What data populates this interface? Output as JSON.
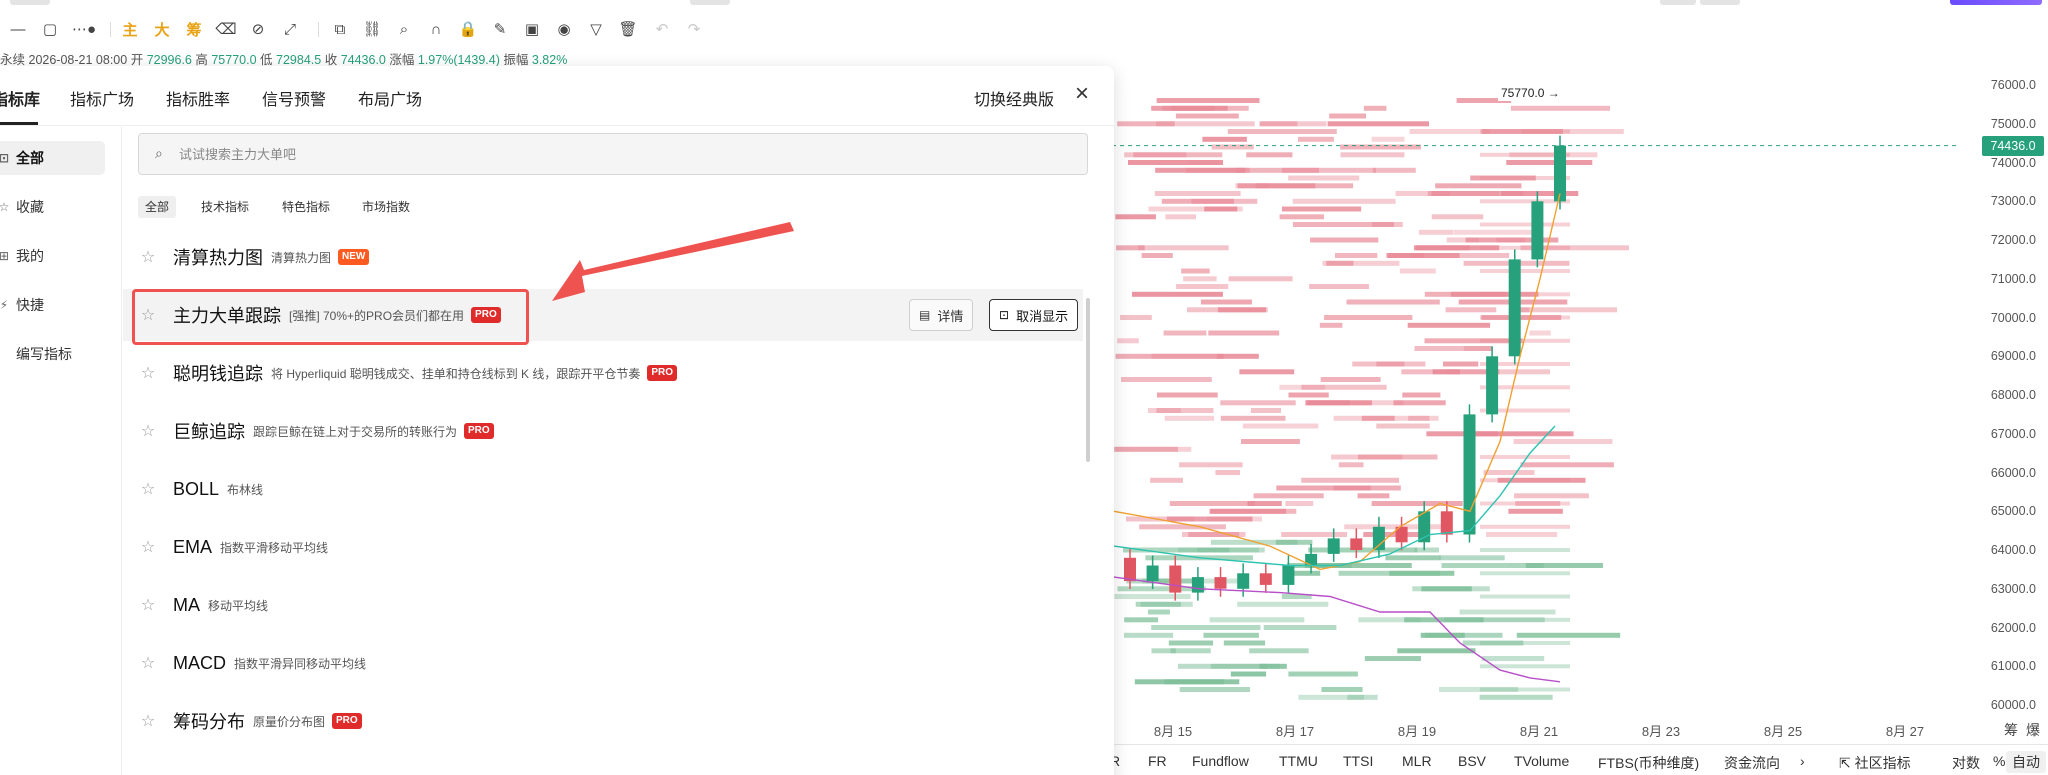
{
  "toolbar": {
    "icons": [
      {
        "name": "minus-line-icon",
        "glyph": "—"
      },
      {
        "name": "rectangle-icon",
        "glyph": "▢"
      },
      {
        "name": "dotted-arrow-icon",
        "glyph": "⋯●"
      },
      {
        "name": "main-chart-icon",
        "glyph": "主"
      },
      {
        "name": "large-icon",
        "glyph": "大"
      },
      {
        "name": "chip-icon",
        "glyph": "筹"
      },
      {
        "name": "eraser-icon",
        "glyph": "⌫"
      },
      {
        "name": "ruler-icon",
        "glyph": "⊘"
      },
      {
        "name": "measure-icon",
        "glyph": "⤢"
      },
      {
        "name": "copy-icon",
        "glyph": "⧉"
      },
      {
        "name": "link-icon",
        "glyph": "⛓"
      },
      {
        "name": "zoom-icon",
        "glyph": "⌕"
      },
      {
        "name": "magnet-icon",
        "glyph": "∩"
      },
      {
        "name": "lock-icon",
        "glyph": "🔒"
      },
      {
        "name": "pen-icon",
        "glyph": "✎"
      },
      {
        "name": "image-icon",
        "glyph": "▣"
      },
      {
        "name": "eye-icon",
        "glyph": "◉"
      },
      {
        "name": "filter-icon",
        "glyph": "▽"
      },
      {
        "name": "trash-icon",
        "glyph": "🗑"
      },
      {
        "name": "undo-icon",
        "glyph": "↶"
      },
      {
        "name": "redo-icon",
        "glyph": "↷"
      }
    ]
  },
  "ohlc": {
    "label": "永续",
    "time": "2026-08-21 08:00",
    "open_label": "开",
    "open": "72996.6",
    "high_label": "高",
    "high": "75770.0",
    "low_label": "低",
    "low": "72984.5",
    "close_label": "收",
    "close": "74436.0",
    "change_label": "涨幅",
    "change": "1.97%(1439.4)",
    "amp_label": "振幅",
    "amp": "3.82%"
  },
  "chart": {
    "high_tag": "75770.0 →",
    "current_price": "74436.0",
    "price_ticks": [
      "76000.0",
      "75000.0",
      "74000.0",
      "73000.0",
      "72000.0",
      "71000.0",
      "70000.0",
      "69000.0",
      "68000.0",
      "67000.0",
      "66000.0",
      "65000.0",
      "64000.0",
      "63000.0",
      "62000.0",
      "61000.0",
      "60000.0"
    ],
    "date_ticks": [
      "8月 15",
      "8月 17",
      "8月 19",
      "8月 21",
      "8月 23",
      "8月 25",
      "8月 27"
    ],
    "corner_labels": [
      "筹",
      "爆"
    ],
    "colors": {
      "up": "#26a17b",
      "down": "#e05663",
      "heat_up": "#7fbf9a",
      "heat_down": "#e88a97",
      "ma_orange": "#f0a030",
      "ma_teal": "#2cc3b0",
      "ma_purple": "#b84fc9",
      "current_line": "#26a17b"
    }
  },
  "bottom_tabs": {
    "items": [
      "R",
      "FR",
      "Fundflow",
      "TTMU",
      "TTSI",
      "MLR",
      "BSV",
      "TVolume",
      "FTBS(币种维度)",
      "资金流向"
    ],
    "more": "›",
    "community": "社区指标",
    "log": "对数",
    "percent": "%",
    "auto": "自动"
  },
  "panel": {
    "tabs": [
      "指标库",
      "指标广场",
      "指标胜率",
      "信号预警",
      "布局广场"
    ],
    "classic": "切换经典版",
    "close": "×",
    "side_items": [
      {
        "icon": "⊡",
        "label": "全部"
      },
      {
        "icon": "☆",
        "label": "收藏"
      },
      {
        "icon": "⊞",
        "label": "我的"
      },
      {
        "icon": "⚡",
        "label": "快捷"
      },
      {
        "icon": "",
        "label": "编写指标"
      }
    ],
    "search_placeholder": "试试搜索主力大单吧",
    "filters": [
      "全部",
      "技术指标",
      "特色指标",
      "市场指数"
    ],
    "items": [
      {
        "name": "清算热力图",
        "desc": "清算热力图",
        "badge": "NEW"
      },
      {
        "name": "主力大单跟踪",
        "desc": "[强推] 70%+的PRO会员们都在用",
        "badge": "PRO"
      },
      {
        "name": "聪明钱追踪",
        "desc": "将 Hyperliquid 聪明钱成交、挂单和持仓线标到 K 线，跟踪开平仓节奏",
        "badge": "PRO"
      },
      {
        "name": "巨鲸追踪",
        "desc": "跟踪巨鲸在链上对于交易所的转账行为",
        "badge": "PRO"
      },
      {
        "name": "BOLL",
        "desc": "布林线",
        "badge": ""
      },
      {
        "name": "EMA",
        "desc": "指数平滑移动平均线",
        "badge": ""
      },
      {
        "name": "MA",
        "desc": "移动平均线",
        "badge": ""
      },
      {
        "name": "MACD",
        "desc": "指数平滑异同移动平均线",
        "badge": ""
      },
      {
        "name": "筹码分布",
        "desc": "原量价分布图",
        "badge": "PRO"
      }
    ],
    "detail_btn": "详情",
    "hide_btn": "取消显示",
    "star": "☆"
  },
  "chart_data": {
    "type": "candlestick",
    "x_label": "",
    "y_label": "",
    "ylim": [
      60000,
      76000
    ],
    "x": [
      "8月 15",
      "8月 17",
      "8月 19",
      "8月 21"
    ],
    "series": [
      {
        "values": [
          {
            "open": 63800,
            "close": 63200
          },
          {
            "open": 63200,
            "close": 63600
          },
          {
            "open": 63600,
            "close": 62900
          },
          {
            "open": 62900,
            "close": 63300
          },
          {
            "open": 63300,
            "close": 63000
          },
          {
            "open": 63000,
            "close": 63400
          },
          {
            "open": 63400,
            "close": 63100
          },
          {
            "open": 63100,
            "close": 63600
          },
          {
            "open": 63600,
            "close": 63900
          },
          {
            "open": 63900,
            "close": 64300
          },
          {
            "open": 64300,
            "close": 64000
          },
          {
            "open": 64000,
            "close": 64600
          },
          {
            "open": 64600,
            "close": 64200
          },
          {
            "open": 64200,
            "close": 65000
          },
          {
            "open": 65000,
            "close": 64400
          },
          {
            "open": 64400,
            "close": 67500
          },
          {
            "open": 67500,
            "close": 69000
          },
          {
            "open": 69000,
            "close": 71500
          },
          {
            "open": 71500,
            "close": 73000
          },
          {
            "open": 72996.6,
            "close": 74436.0
          }
        ]
      }
    ]
  }
}
